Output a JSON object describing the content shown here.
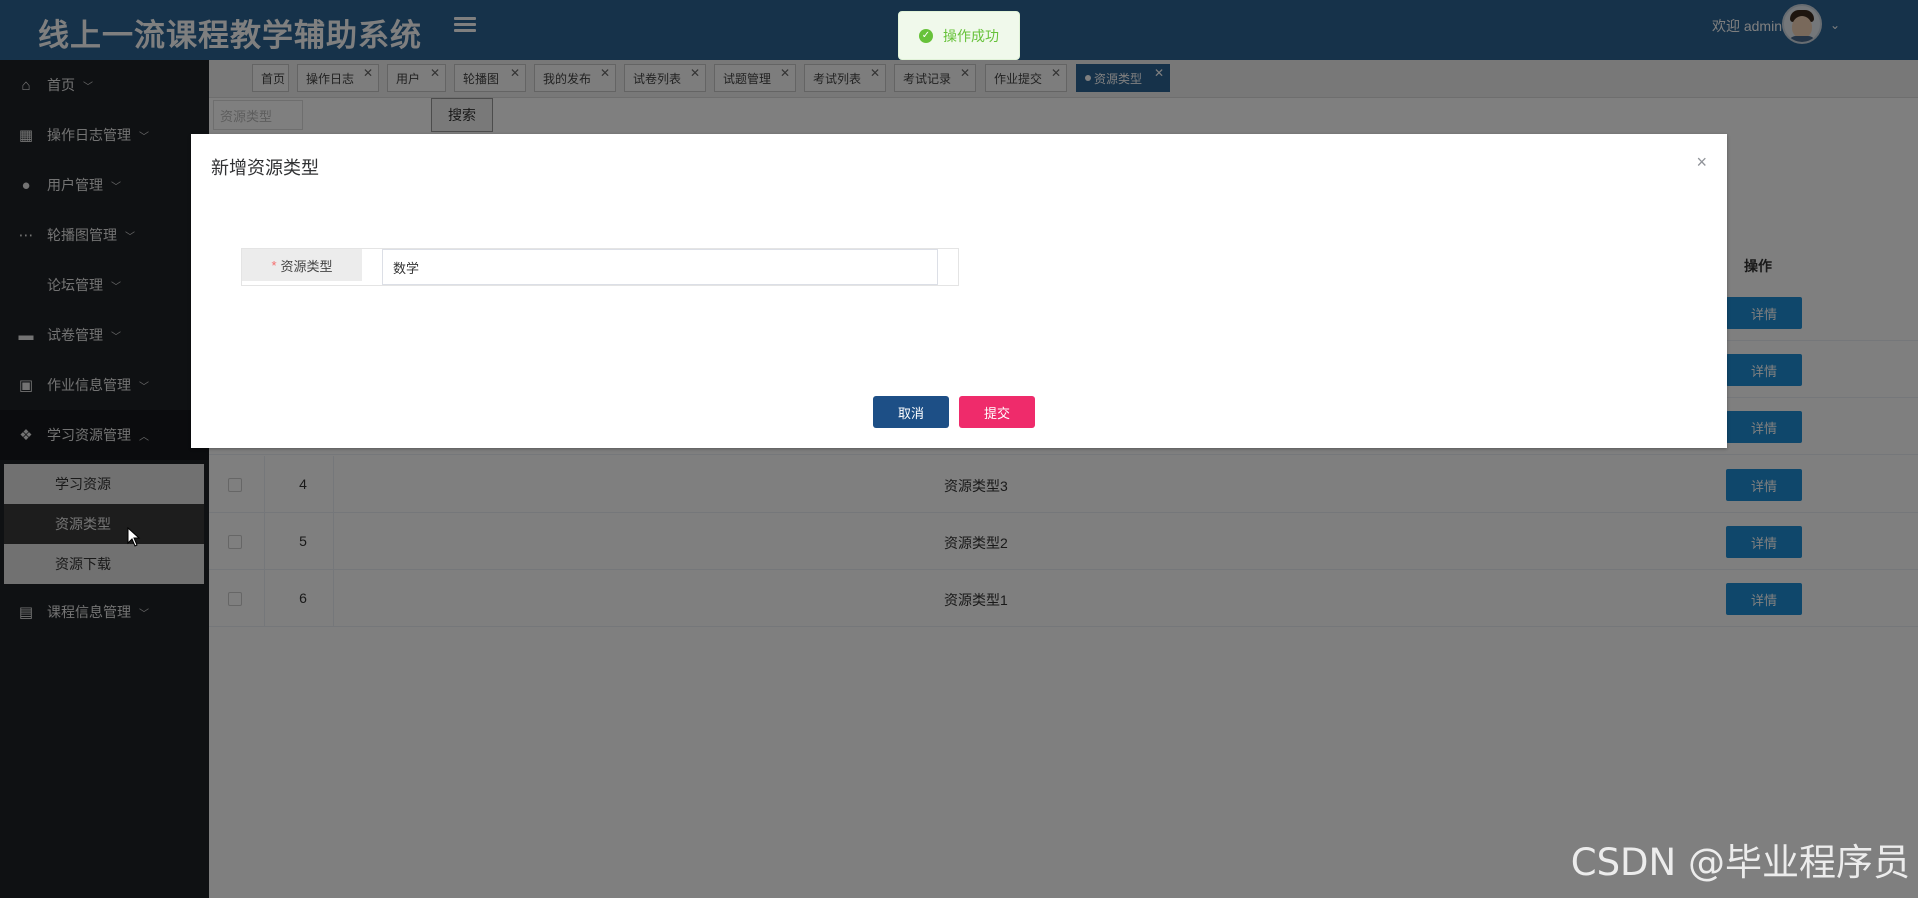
{
  "header": {
    "app_title": "线上一流课程教学辅助系统",
    "welcome": "欢迎 admin"
  },
  "toast": {
    "message": "操作成功"
  },
  "sidebar": {
    "items": [
      {
        "label": "首页",
        "icon": "home-icon"
      },
      {
        "label": "操作日志管理",
        "icon": "grid-icon"
      },
      {
        "label": "用户管理",
        "icon": "user-icon"
      },
      {
        "label": "轮播图管理",
        "icon": "chat-icon"
      },
      {
        "label": "论坛管理",
        "icon": ""
      },
      {
        "label": "试卷管理",
        "icon": "panel-icon"
      },
      {
        "label": "作业信息管理",
        "icon": "image-icon"
      },
      {
        "label": "学习资源管理",
        "icon": "apps-icon"
      },
      {
        "label": "课程信息管理",
        "icon": "building-icon"
      }
    ],
    "subitems": [
      {
        "label": "学习资源"
      },
      {
        "label": "资源类型"
      },
      {
        "label": "资源下载"
      }
    ]
  },
  "tabs": [
    {
      "label": "首页"
    },
    {
      "label": "操作日志"
    },
    {
      "label": "用户"
    },
    {
      "label": "轮播图"
    },
    {
      "label": "我的发布"
    },
    {
      "label": "试卷列表"
    },
    {
      "label": "试题管理"
    },
    {
      "label": "考试列表"
    },
    {
      "label": "考试记录"
    },
    {
      "label": "作业提交"
    },
    {
      "label": "资源类型"
    }
  ],
  "search": {
    "placeholder": "资源类型",
    "button": "搜索"
  },
  "table": {
    "actions_header": "操作",
    "detail_label": "详情",
    "rows": [
      {
        "index": "",
        "name": ""
      },
      {
        "index": "",
        "name": ""
      },
      {
        "index": "",
        "name": ""
      },
      {
        "index": "4",
        "name": "资源类型3"
      },
      {
        "index": "5",
        "name": "资源类型2"
      },
      {
        "index": "6",
        "name": "资源类型1"
      }
    ]
  },
  "dialog": {
    "title": "新增资源类型",
    "field_label": "资源类型",
    "required_mark": "*",
    "field_value": "数学",
    "cancel": "取消",
    "submit": "提交",
    "close": "×"
  },
  "watermark": "CSDN @毕业程序员"
}
